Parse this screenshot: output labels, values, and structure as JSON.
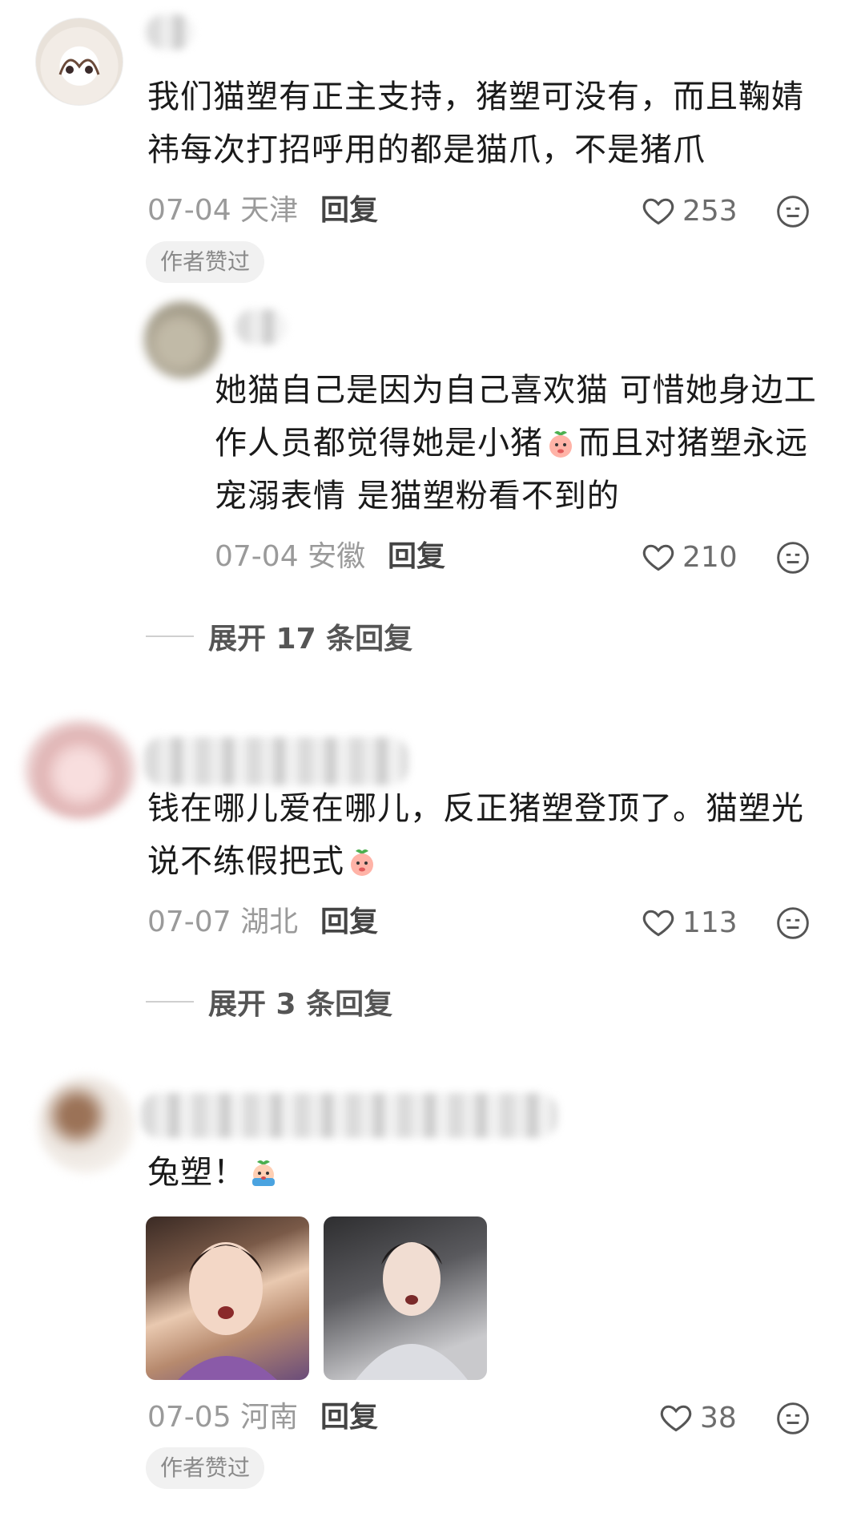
{
  "comments": [
    {
      "text": "我们猫塑有正主支持，猪塑可没有，而且鞠婧祎每次打招呼用的都是猫爪，不是猪爪",
      "date": "07-04",
      "location": "天津",
      "reply_label": "回复",
      "likes": "253",
      "badge": "作者赞过"
    },
    {
      "text_a": "她猫自己是因为自己喜欢猫 可惜她身边工作人员都觉得她是小猪",
      "text_b": "而且对猪塑永远宠溺表情 是猫塑粉看不到的",
      "date": "07-04",
      "location": "安徽",
      "reply_label": "回复",
      "likes": "210",
      "expand_label": "展开 17 条回复",
      "emoji_icon": "peach-face-emoji-icon"
    },
    {
      "text": "钱在哪儿爱在哪儿，反正猪塑登顶了。猫塑光说不练假把式",
      "date": "07-07",
      "location": "湖北",
      "reply_label": "回复",
      "likes": "113",
      "expand_label": "展开 3 条回复",
      "emoji_icon": "peach-face-emoji-icon"
    },
    {
      "text": "兔塑！",
      "date": "07-05",
      "location": "河南",
      "reply_label": "回复",
      "likes": "38",
      "badge": "作者赞过",
      "emoji_icon": "crying-face-emoji-icon"
    }
  ],
  "colors": {
    "meta": "#9a9a9a",
    "badge_bg": "#f1f1f1"
  }
}
